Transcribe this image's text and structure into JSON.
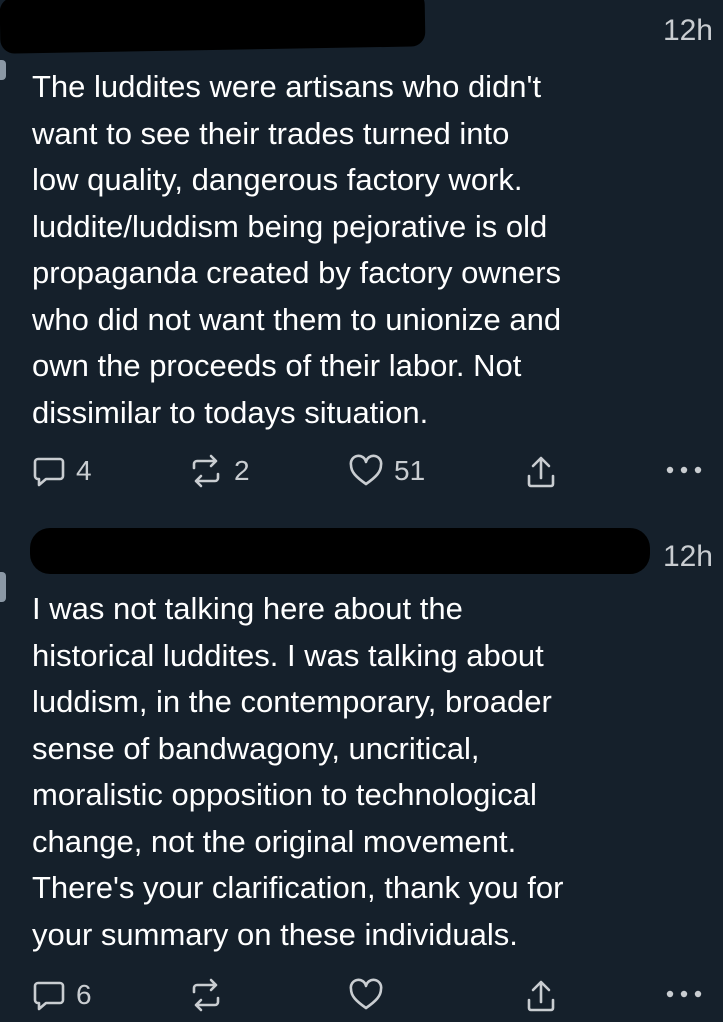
{
  "posts": [
    {
      "time": "12h",
      "text": "The luddites were artisans who didn't\nwant to see their trades turned into\nlow quality, dangerous factory work.\nluddite/luddism being pejorative is old\npropaganda created by factory owners\nwho did not want them to unionize and\nown the proceeds of their labor. Not\ndissimilar to todays situation.",
      "replies": "4",
      "reposts": "2",
      "likes": "51"
    },
    {
      "time": "12h",
      "text": "I was not talking here about the\nhistorical luddites. I was talking about\nluddism, in the contemporary, broader\nsense of bandwagony, uncritical,\nmoralistic opposition to technological\nchange, not the original movement.\nThere's your clarification, thank you for\nyour summary on these individuals.",
      "replies": "6",
      "reposts": "",
      "likes": ""
    }
  ],
  "icons": {
    "reply": "speech-bubble-icon",
    "repost": "repost-arrows-icon",
    "like": "heart-icon",
    "share": "share-upload-icon",
    "more": "more-dots-icon"
  },
  "colors": {
    "background": "#15202b",
    "text": "#ffffff",
    "muted": "#c9cdd1"
  }
}
